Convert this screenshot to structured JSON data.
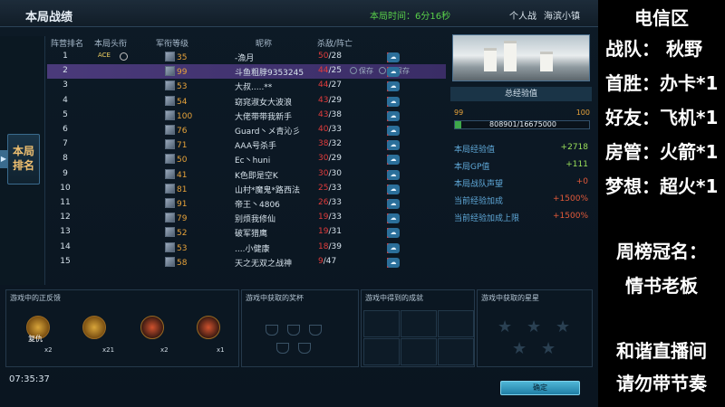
{
  "header": {
    "title": "本局战绩",
    "time": "本局时间：6分16秒",
    "mode": "个人战",
    "map": "海滨小镇"
  },
  "sidetab": {
    "label": "本局排名"
  },
  "columns": [
    "阵营排名",
    "本局头衔",
    "军衔等级",
    "昵称",
    "杀敌/阵亡"
  ],
  "rows": [
    {
      "rank": "1",
      "title": "ACE",
      "level": "35",
      "nick": "-漁月",
      "kills": "50",
      "deaths": "/28"
    },
    {
      "rank": "2",
      "title": "",
      "level": "99",
      "nick": "斗鱼粗脖9353245",
      "kills": "44",
      "deaths": "/25"
    },
    {
      "rank": "3",
      "title": "",
      "level": "53",
      "nick": "大叔.....**",
      "kills": "44",
      "deaths": "/27"
    },
    {
      "rank": "4",
      "title": "",
      "level": "54",
      "nick": "窈窕淑女大波浪",
      "kills": "43",
      "deaths": "/29"
    },
    {
      "rank": "5",
      "title": "",
      "level": "100",
      "nick": "大佬带带我新手",
      "kills": "43",
      "deaths": "/38"
    },
    {
      "rank": "6",
      "title": "",
      "level": "76",
      "nick": "Guard丶メ青沁彡",
      "kills": "40",
      "deaths": "/33"
    },
    {
      "rank": "7",
      "title": "",
      "level": "71",
      "nick": "AAA号杀手",
      "kills": "38",
      "deaths": "/32"
    },
    {
      "rank": "8",
      "title": "",
      "level": "50",
      "nick": "Ec丶huni",
      "kills": "30",
      "deaths": "/29"
    },
    {
      "rank": "9",
      "title": "",
      "level": "41",
      "nick": "K色即是空K",
      "kills": "30",
      "deaths": "/30"
    },
    {
      "rank": "10",
      "title": "",
      "level": "81",
      "nick": "山村*魔鬼*路西法",
      "kills": "25",
      "deaths": "/33"
    },
    {
      "rank": "11",
      "title": "",
      "level": "91",
      "nick": "帝王丶4806",
      "kills": "26",
      "deaths": "/33"
    },
    {
      "rank": "12",
      "title": "",
      "level": "79",
      "nick": "别烦我修仙",
      "kills": "19",
      "deaths": "/33"
    },
    {
      "rank": "13",
      "title": "",
      "level": "52",
      "nick": "破军猎鹰",
      "kills": "19",
      "deaths": "/31"
    },
    {
      "rank": "14",
      "title": "",
      "level": "53",
      "nick": "....小健康",
      "kills": "18",
      "deaths": "/39"
    },
    {
      "rank": "15",
      "title": "",
      "level": "58",
      "nick": "天之无双之战神",
      "kills": "9",
      "deaths": "/47"
    }
  ],
  "row2_actions": {
    "save": "保存",
    "nosave": "不保存"
  },
  "right": {
    "exp_header": "总经验值",
    "lvl_from": "99",
    "lvl_to": "100",
    "exp_text": "808901/16675000",
    "exp_fraction": 0.048,
    "stats": [
      {
        "label": "本局经验值",
        "value": "+2718",
        "color": "green"
      },
      {
        "label": "本局GP值",
        "value": "+111",
        "color": "green"
      },
      {
        "label": "本局战队声望",
        "value": "+0",
        "color": "red"
      },
      {
        "label": "当前经验加成",
        "value": "+1500%",
        "color": "red"
      },
      {
        "label": "当前经验加成上限",
        "value": "+1500%",
        "color": "red"
      }
    ]
  },
  "bottom": {
    "p1": "游戏中的正反馈",
    "p2": "游戏中获取的奖杯",
    "p3": "游戏中得到的成就",
    "p4": "游戏中获取的星星",
    "medals": [
      {
        "name": "复仇",
        "count": "x2"
      },
      {
        "name": "",
        "count": "x21"
      },
      {
        "name": "",
        "count": "x2"
      },
      {
        "name": "",
        "count": "x1"
      }
    ]
  },
  "clock": "07:35:37",
  "confirm": "确定",
  "overlay": {
    "l1": "电信区",
    "l2": "战队：  秋野",
    "l3": "首胜：办卡*1",
    "l4": "好友：飞机*1",
    "l5": "房管：火箭*1",
    "l6": "梦想：超火*1",
    "l7": "周榜冠名：",
    "l8": "情书老板",
    "l9": "和谐直播间",
    "l10": "请勿带节奏"
  }
}
